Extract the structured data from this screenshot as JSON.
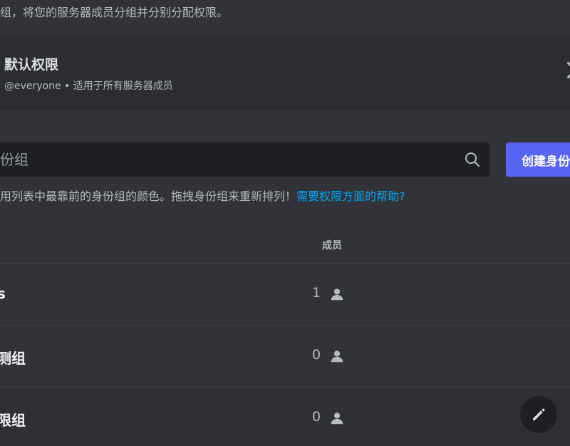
{
  "header": {
    "description": "组，将您的服务器成员分组并分别分配权限。"
  },
  "default_permissions": {
    "title": "默认权限",
    "subtitle": "@everyone • 适用于所有服务器成员",
    "chevron_icon": "chevron-right-icon"
  },
  "search": {
    "placeholder": "份组",
    "value": "",
    "icon": "search-icon"
  },
  "create_button": {
    "label": "创建身份组"
  },
  "hint": {
    "text": "用列表中最靠前的身份组的颜色。拖拽身份组来重新排列！",
    "link": "需要权限方面的帮助?"
  },
  "table": {
    "members_header": "成员",
    "rows": [
      {
        "name": "s",
        "members": "1"
      },
      {
        "name": "测组",
        "members": "0"
      },
      {
        "name": "限组",
        "members": "0"
      }
    ]
  },
  "colors": {
    "background": "#313338",
    "panel": "#2b2d31",
    "input": "#1e1f22",
    "accent": "#5865f2",
    "link": "#00a8fc"
  }
}
